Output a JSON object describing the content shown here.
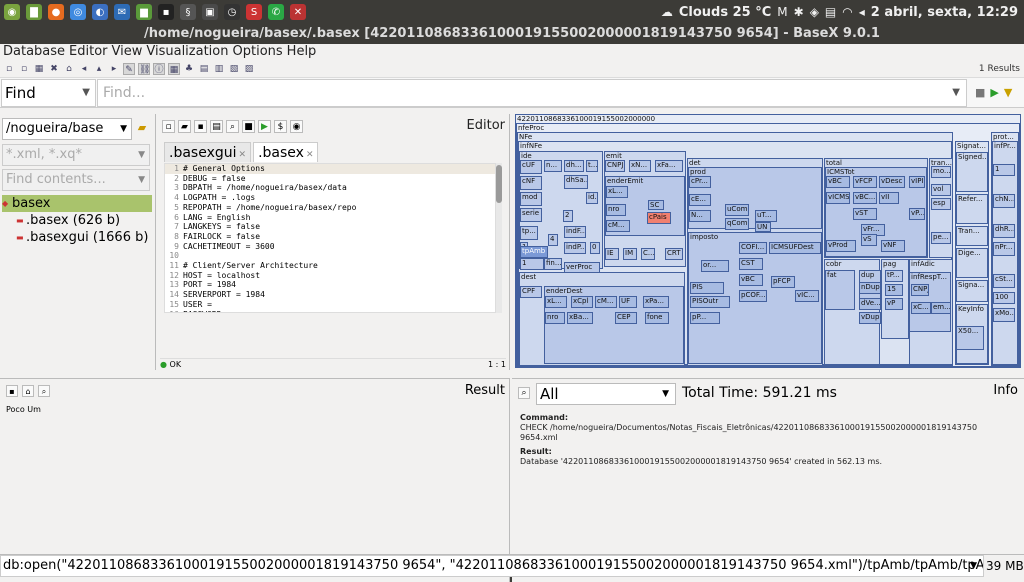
{
  "system": {
    "weather": "Clouds 25 °C",
    "datetime": "2 abril, sexta, 12:29"
  },
  "window": {
    "title": "/home/nogueira/basex/.basex [4220110868336100019155002000001819143750 9654] - BaseX 9.0.1"
  },
  "menu": [
    "Database",
    "Editor",
    "View",
    "Visualization",
    "Options",
    "Help"
  ],
  "toolbar": {
    "results": "1 Results"
  },
  "find": {
    "mode": "Find",
    "placeholder": "Find..."
  },
  "left": {
    "path": "/nogueira/base",
    "filter_placeholder": "*.xml, *.xq*",
    "contents_placeholder": "Find contents...",
    "tree": [
      {
        "label": "basex",
        "selected": true
      },
      {
        "label": ".basex (626 b)"
      },
      {
        "label": ".basexgui (1666 b)"
      }
    ]
  },
  "editor": {
    "title": "Editor",
    "tabs": [
      ".basexgui",
      ".basex"
    ],
    "lines": [
      "# General Options",
      "DEBUG = false",
      "DBPATH = /home/nogueira/basex/data",
      "LOGPATH = .logs",
      "REPOPATH = /home/nogueira/basex/repo",
      "LANG = English",
      "LANGKEYS = false",
      "FAIRLOCK = false",
      "CACHETIMEOUT = 3600",
      "",
      "# Client/Server Architecture",
      "HOST = localhost",
      "PORT = 1984",
      "SERVERPORT = 1984",
      "USER =",
      "PASSWORD ="
    ],
    "status_left": "OK",
    "status_right": "1 : 1"
  },
  "map": {
    "root": "4220110868336100019155002000000",
    "boxes": {
      "nfeProc": "nfeProc",
      "NFe": "NFe",
      "infNFe": "infNFe",
      "ide": "ide",
      "emit": "emit",
      "det": "det",
      "total": "total",
      "tran": "tran...",
      "signat": "Signat...",
      "prot": "prot...",
      "prod": "prod",
      "imposto": "imposto",
      "dest": "dest",
      "enderDest": "enderDest",
      "cobr": "cobr",
      "pag": "pag",
      "infAdic": "infAdic",
      "ICMSTot": "ICMSTot",
      "tpAmb": "tpAmb",
      "verProc": "verProc",
      "enderEmit": "enderEmit",
      "cPais": "cPais",
      "PIS": "PIS",
      "PISOutr": "PISOutr",
      "COFINS": "COFI...",
      "ICMSUFDest": "ICMSUFDest",
      "fat": "fat",
      "dup": "dup",
      "infRespT": "infRespT...",
      "KeyInfo": "KeyInfo",
      "X509": "X50...",
      "SignedInfo": "Signed...",
      "infProt": "infPr...",
      "cUF": "cUF",
      "cNF": "cNF",
      "mod": "mod",
      "serie": "serie",
      "dhEmi": "dh...",
      "dhSai": "dhSa...",
      "tpImp": "tp...",
      "finNFe": "fin...",
      "indPres": "indP...",
      "CNPJ": "CNPJ",
      "xNome": "xN...",
      "xFant": "xFa...",
      "IE": "IE",
      "IM": "IM",
      "CNAE": "C...",
      "CRT": "CRT",
      "cProd": "cPr...",
      "cEAN": "cE...",
      "NCM": "N...",
      "uCom": "uCom",
      "qCom": "qCom",
      "uTrib": "uT...",
      "vBC": "vBC",
      "vICMS": "vICMS",
      "vBCST": "vBC...",
      "vST": "vST",
      "vProd": "vProd",
      "vFrete": "vFr...",
      "vSeg": "vS",
      "vNF": "vNF",
      "vFCP": "vFCP",
      "vDesc": "vDesc",
      "vII": "vII",
      "vIPI": "vIPI",
      "vPIS": "vP...",
      "vol": "vol",
      "esp": "esp",
      "pesoL": "pe...",
      "CPF": "CPF",
      "xLgr": "xL...",
      "xCpl": "xCpl",
      "xMun": "cM...",
      "UF": "UF",
      "xPais": "xPa...",
      "nro": "nro",
      "xBairro": "xBa...",
      "CEP": "CEP",
      "fone": "fone",
      "CST": "CST",
      "pPIS": "pP...",
      "pCOFINS": "pCOF...",
      "nDup": "nDup",
      "dVenc": "dVe...",
      "vDup": "vDup",
      "tPag": "tP...",
      "vPag": "vP",
      "CNPJresp": "CNPJ",
      "xContato": "xC...",
      "email": "em...",
      "reference": "Refer...",
      "transforms": "Tran...",
      "digest": "Dige...",
      "sigvalue": "Signa...",
      "chNFe": "chN...",
      "dhRecbto": "dhR...",
      "nProt": "nPr...",
      "cStat": "cSt...",
      "cStatVal": "100",
      "xMotivo": "xMo...",
      "tpAmbVal": "1",
      "one": "1",
      "n4": "4",
      "n2": "2",
      "n0": "0",
      "sc": "SC",
      "un": "UN",
      "n15": "15",
      "n0b": "0",
      "mo": "mo...",
      "vOrig": "vO...",
      "vLiq": "vL...",
      "nFat": "nF...",
      "indFinal": "indF...",
      "tpNF": "t...",
      "idDest": "id...",
      "natOp": "n...",
      "tpEmis": "tp...",
      "cMunFG": "cM...",
      "pICMS": "pIC...",
      "orig": "or...",
      "vICMSUF": "vICMS...",
      "pFCP": "pFCP",
      "vICMSUFRemet": "vIC..."
    }
  },
  "result": {
    "title": "Result",
    "body": "Poco Um"
  },
  "info": {
    "title": "Info",
    "filter": "All",
    "total_time": "Total Time: 591.21 ms",
    "command_label": "Command:",
    "command": "CHECK /home/nogueira/Documentos/Notas_Fiscais_Eletrônicas/4220110868336100019155002000001819143750 9654.xml",
    "result_label": "Result:",
    "result": "Database '4220110868336100019155002000001819143750 9654' created in 562.13 ms."
  },
  "status": {
    "command": "db:open(\"4220110868336100019155002000001819143750 9654\", \"4220110868336100019155002000001819143750 9654.xml\")/tpAmb/tpAmb/tpAm...",
    "memory": "39 MB"
  }
}
